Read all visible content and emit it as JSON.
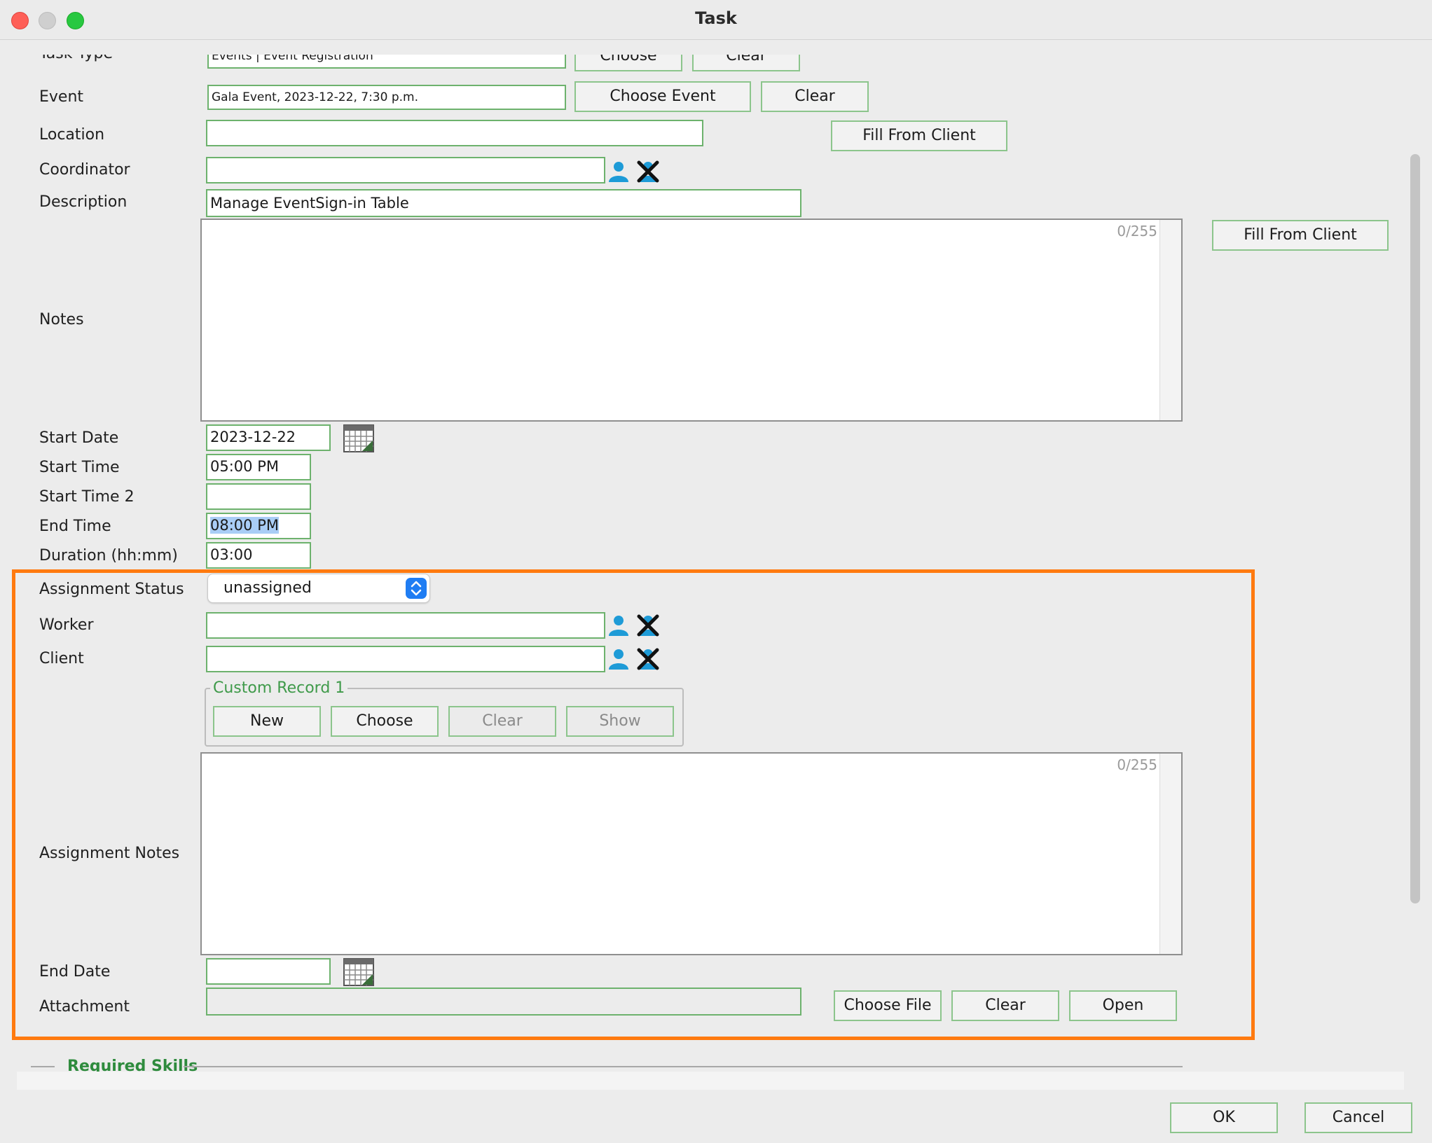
{
  "window": {
    "title": "Task"
  },
  "fields": {
    "task_type": {
      "label": "Task Type",
      "value": "Events | Event Registration",
      "choose": "Choose",
      "clear": "Clear"
    },
    "event": {
      "label": "Event",
      "value": "Gala Event, 2023-12-22, 7:30 p.m.",
      "choose": "Choose Event",
      "clear": "Clear"
    },
    "location": {
      "label": "Location",
      "value": "",
      "fill_button": "Fill From Client"
    },
    "coordinator": {
      "label": "Coordinator",
      "value": ""
    },
    "description": {
      "label": "Description",
      "value": "Manage EventSign-in Table"
    },
    "notes": {
      "label": "Notes",
      "counter": "0/255",
      "fill_button": "Fill From Client"
    },
    "start_date": {
      "label": "Start Date",
      "value": "2023-12-22"
    },
    "start_time": {
      "label": "Start Time",
      "value": "05:00 PM"
    },
    "start_time_2": {
      "label": "Start Time 2",
      "value": ""
    },
    "end_time": {
      "label": "End Time",
      "value": "08:00 PM"
    },
    "duration": {
      "label": "Duration (hh:mm)",
      "value": "03:00"
    }
  },
  "assignment": {
    "status_label": "Assignment Status",
    "status_value": "unassigned",
    "worker_label": "Worker",
    "worker_value": "",
    "client_label": "Client",
    "client_value": "",
    "custom_record": {
      "title": "Custom Record 1",
      "new": "New",
      "choose": "Choose",
      "clear": "Clear",
      "show": "Show"
    },
    "notes_label": "Assignment Notes",
    "notes_counter": "0/255",
    "end_date_label": "End Date",
    "end_date_value": "",
    "attachment_label": "Attachment",
    "attachment_value": "",
    "choose_file": "Choose File",
    "clear": "Clear",
    "open": "Open"
  },
  "required_skills": {
    "title": "Required Skills"
  },
  "footer": {
    "ok": "OK",
    "cancel": "Cancel"
  },
  "colors": {
    "highlight": "#ff7a0f",
    "field_border": "#6db26d",
    "icon_blue": "#1e9bd7"
  }
}
